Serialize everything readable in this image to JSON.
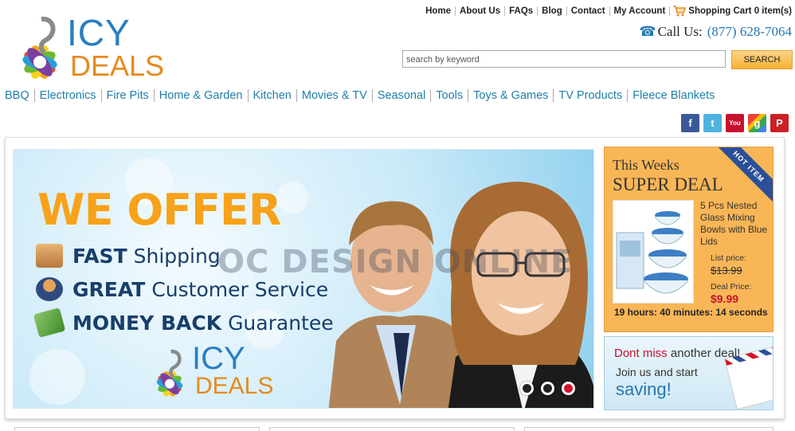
{
  "brand": {
    "word1": "ICY",
    "word2": "DEALS"
  },
  "top_nav": {
    "links": [
      "Home",
      "About Us",
      "FAQs",
      "Blog",
      "Contact",
      "My Account"
    ],
    "cart": "Shopping Cart 0 item(s)"
  },
  "contact": {
    "label": "Call Us:",
    "phone": "(877) 628-7064"
  },
  "search": {
    "placeholder": "search by keyword",
    "button": "SEARCH"
  },
  "categories": [
    "BBQ",
    "Electronics",
    "Fire Pits",
    "Home & Garden",
    "Kitchen",
    "Movies & TV",
    "Seasonal",
    "Tools",
    "Toys & Games",
    "TV Products",
    "Fleece Blankets"
  ],
  "social": [
    {
      "icon": "facebook-icon",
      "glyph": "f",
      "color": "#3b5998"
    },
    {
      "icon": "twitter-icon",
      "glyph": "t",
      "color": "#4fb3e0"
    },
    {
      "icon": "youtube-icon",
      "glyph": "You",
      "color": "#c8102e"
    },
    {
      "icon": "google-plus-icon",
      "glyph": "g",
      "color": "#35a853"
    },
    {
      "icon": "pinterest-icon",
      "glyph": "P",
      "color": "#cb2027"
    }
  ],
  "banner": {
    "headline": "WE OFFER",
    "features": [
      {
        "bold": "FAST",
        "rest": "Shipping"
      },
      {
        "bold": "GREAT",
        "rest": "Customer Service"
      },
      {
        "bold": "MONEY BACK",
        "rest": "Guarantee"
      }
    ],
    "watermark": "OC DESIGN ONLINE",
    "logo_word1": "ICY",
    "logo_word2": "DEALS",
    "slide_count": 3,
    "active_slide": 3
  },
  "deal": {
    "line1": "This Weeks",
    "line2": "SUPER DEAL",
    "ribbon": "HOT ITEM",
    "product": "5 Pcs Nested Glass Mixing Bowls with Blue Lids",
    "list_label": "List price:",
    "list_price": "$13.99",
    "deal_label": "Deal Price:",
    "deal_price": "$9.99",
    "timer": "19 hours: 40 minutes: 14 seconds"
  },
  "promo": {
    "red": "Dont miss",
    "gray": "another deal!",
    "line2": "Join us and start",
    "line3": "saving!"
  }
}
